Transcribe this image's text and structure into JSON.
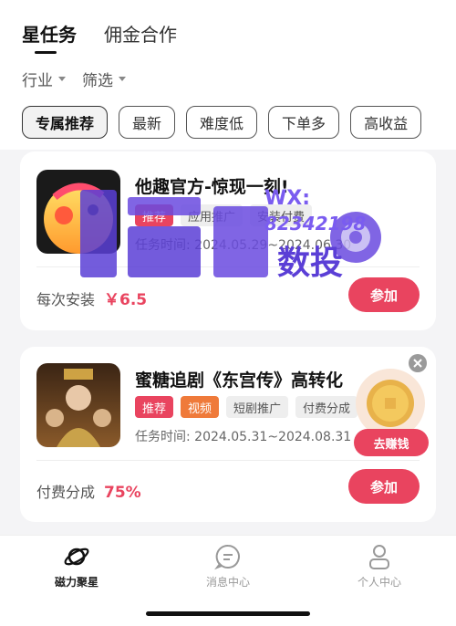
{
  "header": {
    "tabs": [
      {
        "label": "星任务",
        "active": true
      },
      {
        "label": "佣金合作",
        "active": false
      }
    ]
  },
  "filters": {
    "industry": "行业",
    "screen": "筛选"
  },
  "chips": [
    "专属推荐",
    "最新",
    "难度低",
    "下单多",
    "高收益"
  ],
  "tasks": [
    {
      "title": "他趣官方-惊现一刻!",
      "tags": [
        "推荐",
        "应用推广",
        "安装付费"
      ],
      "time": "任务时间: 2024.05.29~2024.06.30",
      "reward_label": "每次安装",
      "reward_value": "￥6.5",
      "join_label": "参加"
    },
    {
      "title": "蜜糖追剧《东宫传》高转化",
      "tags": [
        "推荐",
        "视频",
        "短剧推广",
        "付费分成"
      ],
      "time": "任务时间: 2024.05.31~2024.08.31",
      "reward_label": "付费分成",
      "reward_value": "75%",
      "join_label": "参加"
    }
  ],
  "floater": {
    "button_label": "去赚钱"
  },
  "watermark": {
    "line1": "WX:",
    "line2": "82342198",
    "brand": "数投"
  },
  "nav": [
    {
      "label": "磁力聚星",
      "active": true
    },
    {
      "label": "消息中心",
      "active": false
    },
    {
      "label": "个人中心",
      "active": false
    }
  ],
  "colors": {
    "accent": "#e9445f",
    "tag_orange": "#ef7a3a"
  }
}
